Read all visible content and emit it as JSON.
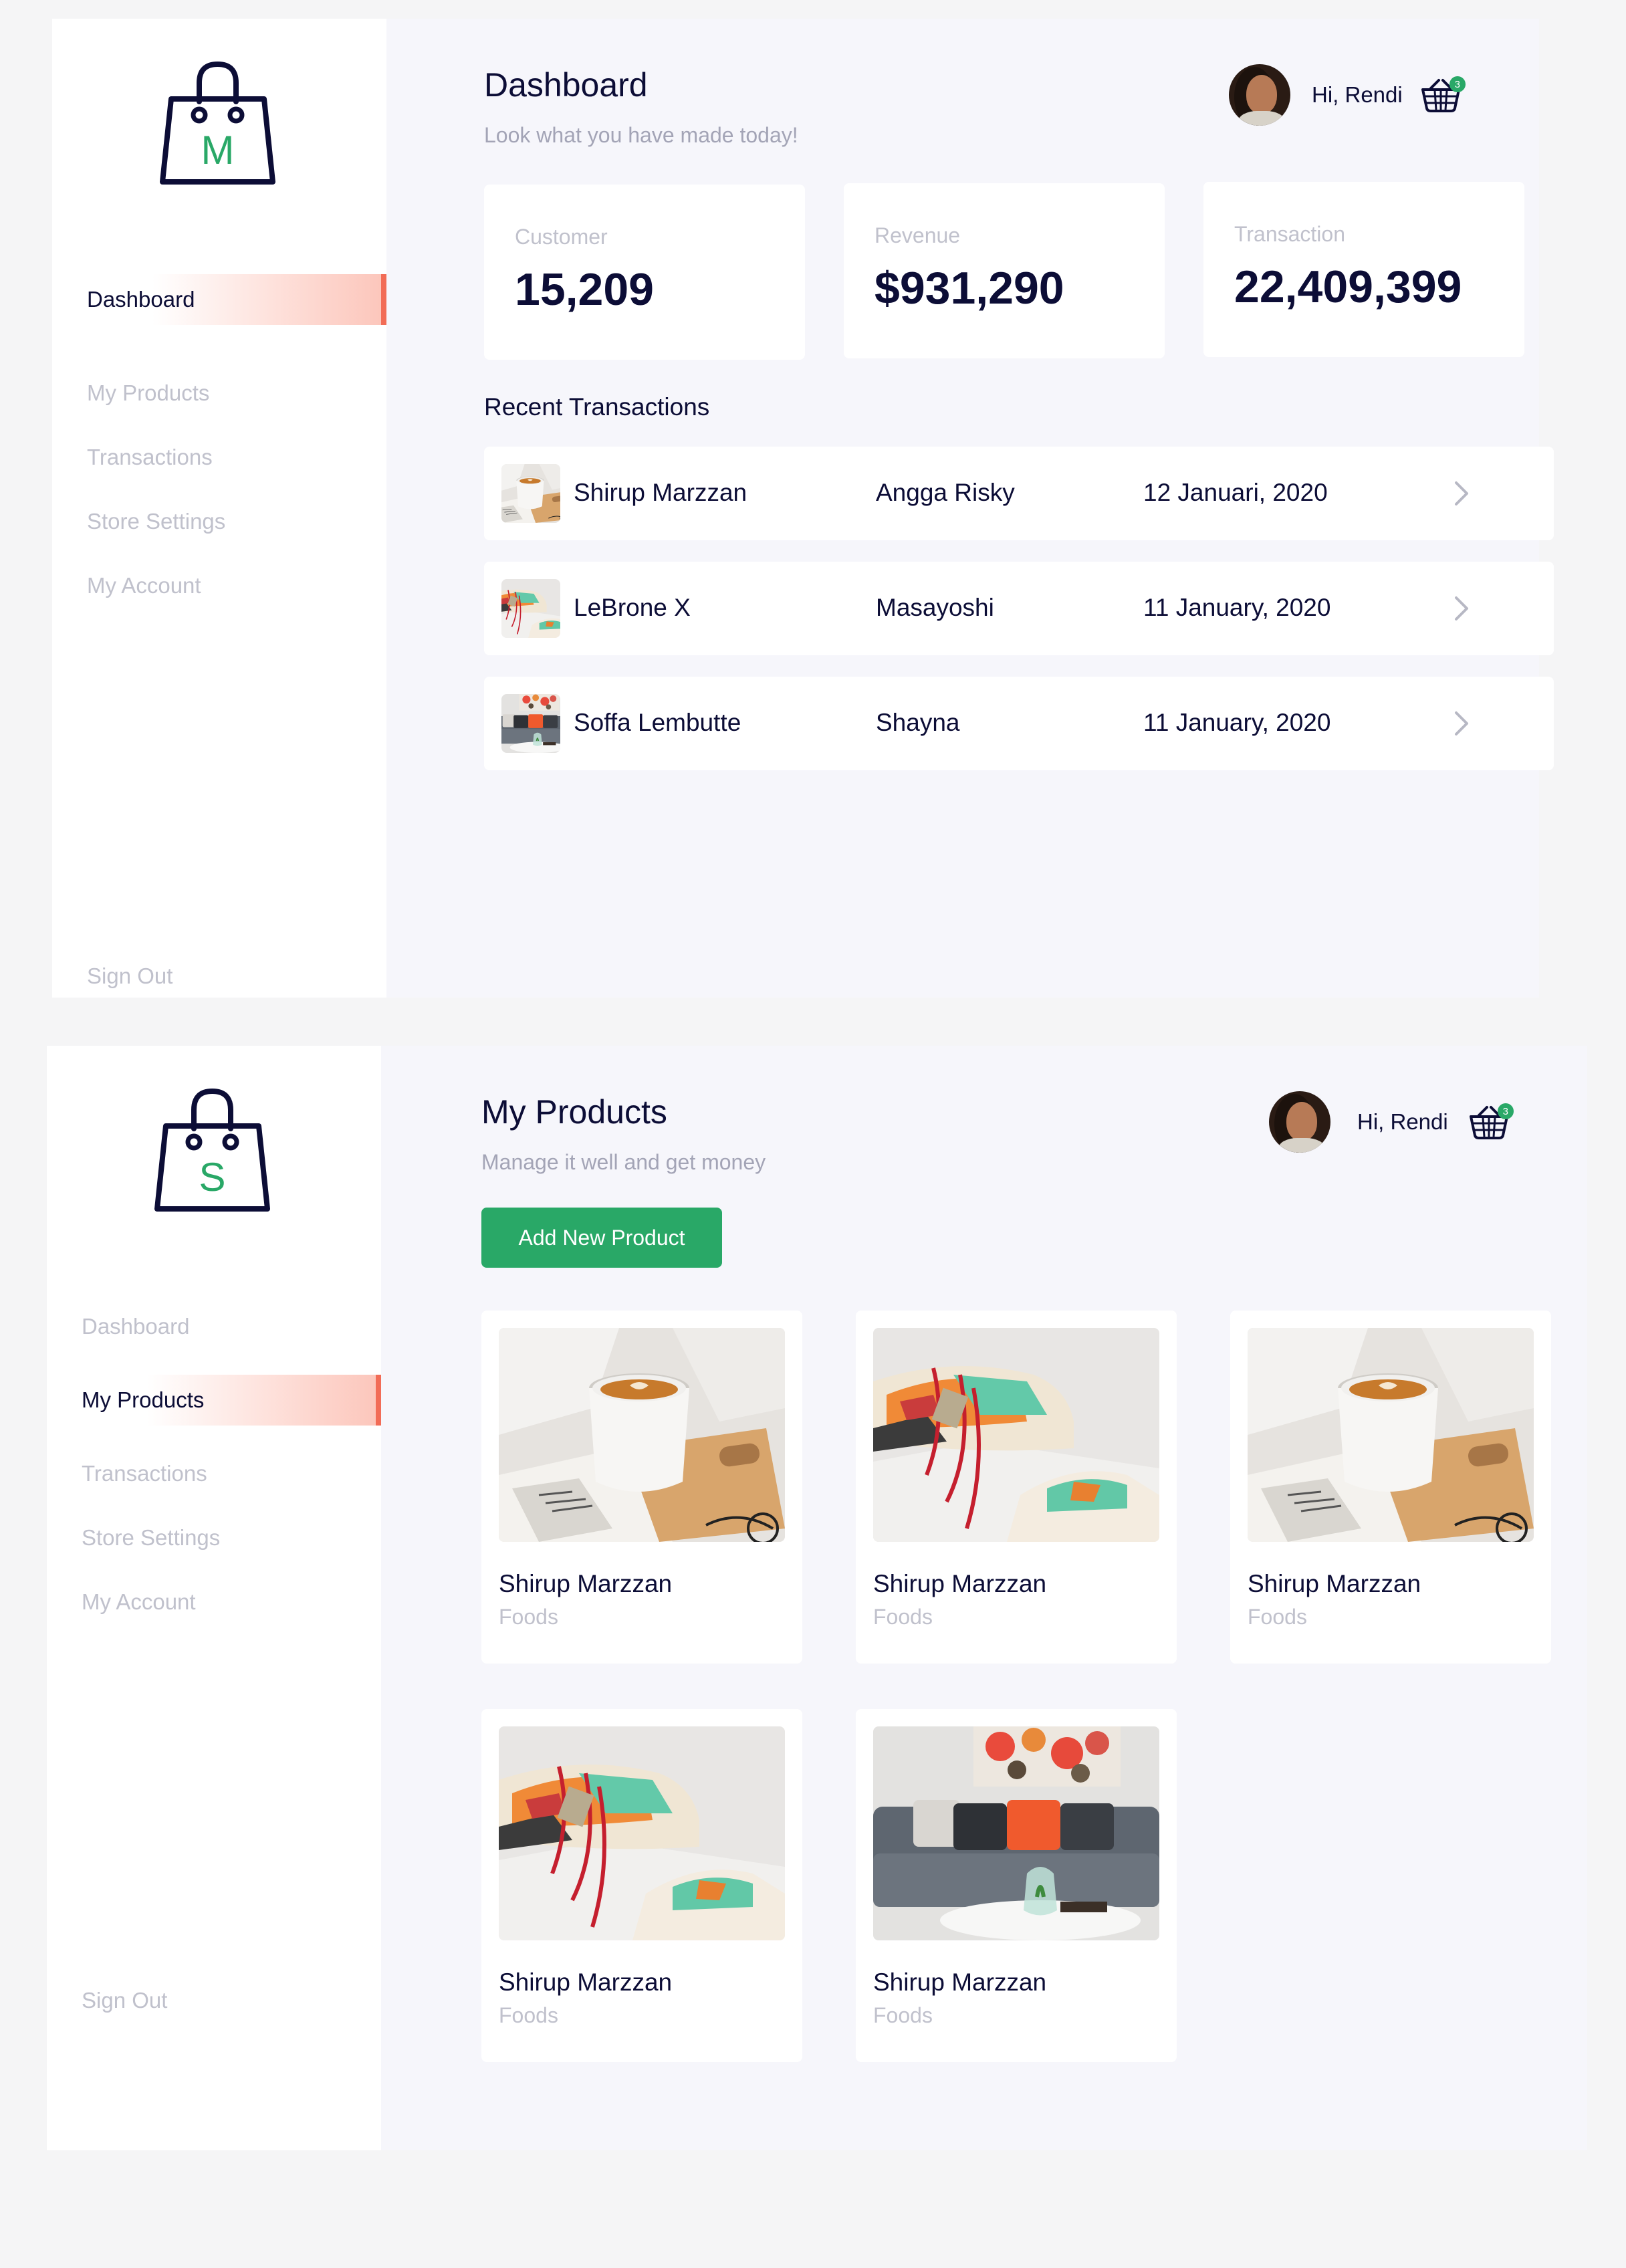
{
  "colors": {
    "accent_green": "#29a867",
    "active_nav": "#f26c56",
    "text_dark": "#0c0d36",
    "text_muted": "#c0c1cc"
  },
  "dashboard": {
    "logo_letter": "M",
    "nav": [
      "Dashboard",
      "My Products",
      "Transactions",
      "Store Settings",
      "My Account"
    ],
    "active_nav": "Dashboard",
    "sign_out": "Sign Out",
    "title": "Dashboard",
    "subtitle": "Look what you have made today!",
    "user": {
      "greeting": "Hi, Rendi",
      "cart_count": "3"
    },
    "stats": [
      {
        "label": "Customer",
        "value": "15,209"
      },
      {
        "label": "Revenue",
        "value": "$931,290"
      },
      {
        "label": "Transaction",
        "value": "22,409,399"
      }
    ],
    "recent_title": "Recent Transactions",
    "transactions": [
      {
        "product": "Shirup Marzzan",
        "customer": "Angga Risky",
        "date": "12 Januari, 2020",
        "thumb": "coffee-cup"
      },
      {
        "product": "LeBrone X",
        "customer": "Masayoshi",
        "date": "11 January, 2020",
        "thumb": "sneaker"
      },
      {
        "product": "Soffa Lembutte",
        "customer": "Shayna",
        "date": "11 January, 2020",
        "thumb": "sofa"
      }
    ]
  },
  "products_page": {
    "logo_letter": "S",
    "nav": [
      "Dashboard",
      "My Products",
      "Transactions",
      "Store Settings",
      "My Account"
    ],
    "active_nav": "My Products",
    "sign_out": "Sign Out",
    "title": "My Products",
    "subtitle": "Manage it well and get money",
    "add_button": "Add New Product",
    "user": {
      "greeting": "Hi, Rendi",
      "cart_count": "3"
    },
    "products": [
      {
        "name": "Shirup Marzzan",
        "category": "Foods",
        "image": "coffee-cup"
      },
      {
        "name": "Shirup Marzzan",
        "category": "Foods",
        "image": "sneaker"
      },
      {
        "name": "Shirup Marzzan",
        "category": "Foods",
        "image": "coffee-cup"
      },
      {
        "name": "Shirup Marzzan",
        "category": "Foods",
        "image": "sneaker"
      },
      {
        "name": "Shirup Marzzan",
        "category": "Foods",
        "image": "sofa"
      }
    ]
  }
}
